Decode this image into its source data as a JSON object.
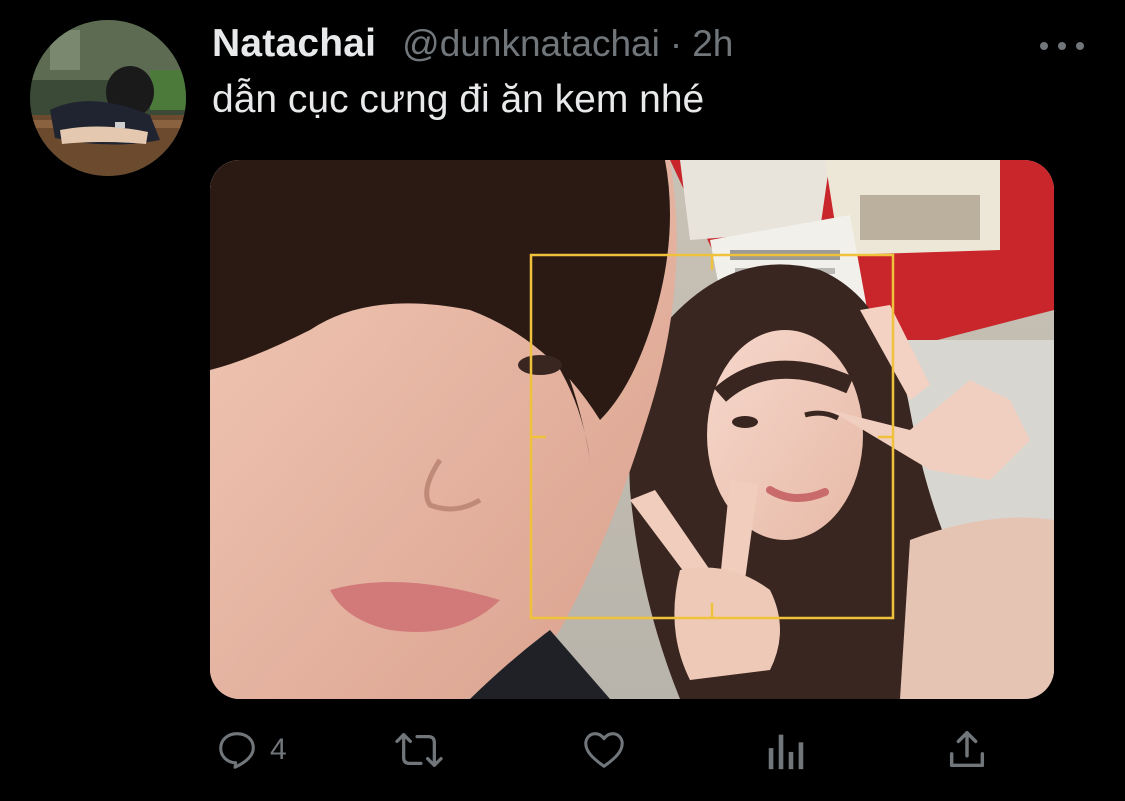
{
  "tweet": {
    "display_name": "Natachai",
    "handle": "@dunknatachai",
    "separator": "·",
    "timestamp": "2h",
    "text": "dẫn cục cưng đi ăn kem nhé"
  },
  "actions": {
    "reply_count": "4"
  },
  "icons": {
    "more": "more-icon",
    "reply": "reply-icon",
    "retweet": "retweet-icon",
    "like": "heart-icon",
    "analytics": "analytics-icon",
    "share": "share-icon"
  },
  "colors": {
    "background": "#000000",
    "text_primary": "#e7e9ea",
    "text_secondary": "#71767b",
    "focus_frame": "#f0c23c"
  }
}
